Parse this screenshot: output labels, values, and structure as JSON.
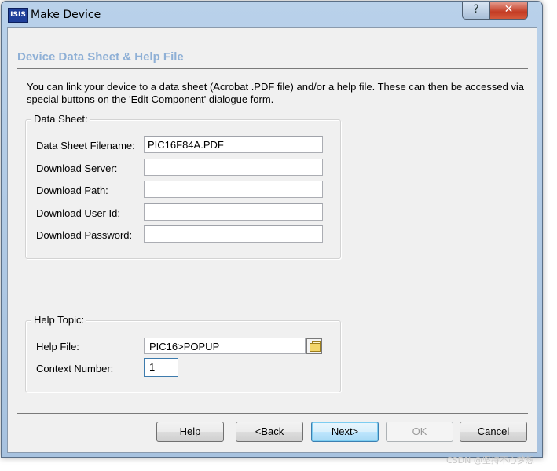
{
  "window": {
    "app_icon_text": "ISIS",
    "title": "Make Device",
    "help_button": "?",
    "close_button": "✕"
  },
  "header": {
    "title": "Device Data Sheet & Help File"
  },
  "intro_text": "You can link your device to a data sheet (Acrobat .PDF file) and/or a help file. These can then be accessed via special buttons on the 'Edit Component' dialogue form.",
  "data_sheet": {
    "group_label": "Data Sheet:",
    "filename_label": "Data Sheet Filename:",
    "filename_value": "PIC16F84A.PDF",
    "server_label": "Download Server:",
    "server_value": "",
    "path_label": "Download Path:",
    "path_value": "",
    "user_label": "Download User Id:",
    "user_value": "",
    "password_label": "Download Password:",
    "password_value": ""
  },
  "help_topic": {
    "group_label": "Help Topic:",
    "file_label": "Help File:",
    "file_value": "PIC16>POPUP",
    "context_label": "Context Number:",
    "context_value": "1"
  },
  "buttons": {
    "help": "Help",
    "back": "<Back",
    "next": "Next>",
    "ok": "OK",
    "cancel": "Cancel"
  },
  "watermark": "CSDN @坚持不心梦想"
}
